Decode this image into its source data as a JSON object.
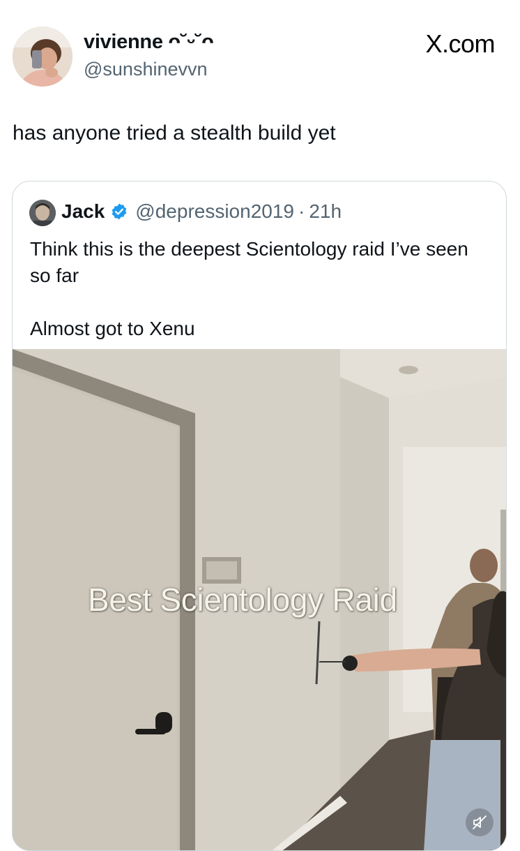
{
  "author": {
    "display_name": "vivienne ᴖ˘ᵕ˘ᴖ",
    "handle": "@sunshinevvn"
  },
  "site_logo": "X.com",
  "tweet": {
    "text": "has anyone tried a stealth build yet"
  },
  "quoted_tweet": {
    "name": "Jack",
    "handle": "@depression2019",
    "separator": "·",
    "time": "21h",
    "text_line1": "Think this is the deepest Scientology raid I’ve seen so far",
    "text_line2": "Almost got to Xenu",
    "verified_badge_color": "#1d9bf0",
    "video": {
      "caption": "Best Scientology Raid",
      "mute_icon": "speaker-muted-icon"
    }
  },
  "colors": {
    "text_primary": "#0f1419",
    "text_secondary": "#536471",
    "border": "#cfd9de"
  }
}
